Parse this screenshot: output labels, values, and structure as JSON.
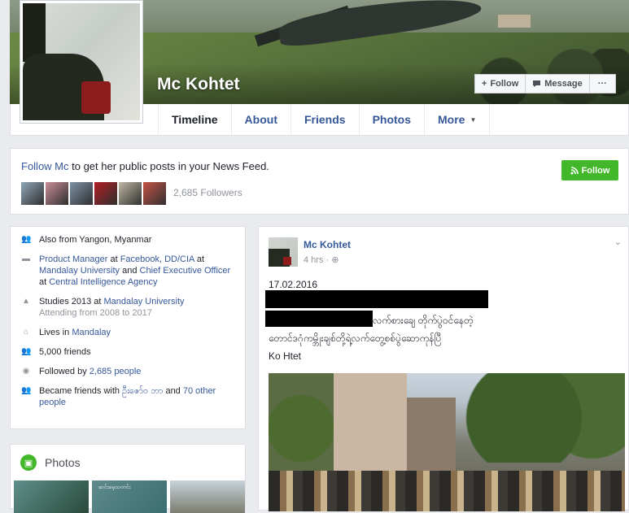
{
  "profile": {
    "name": "Mc Kohtet",
    "buttons": {
      "follow": "Follow",
      "message": "Message",
      "more": "···"
    }
  },
  "tabs": [
    "Timeline",
    "About",
    "Friends",
    "Photos",
    "More"
  ],
  "follow_box": {
    "prefix": "Follow Mc",
    "suffix": " to get her public posts in your News Feed.",
    "followers": "2,685 Followers",
    "button": "Follow",
    "avatar_colors": [
      "#8fa7b8",
      "#c98d99",
      "#7d92a8",
      "#b21f24",
      "#bfb7a4",
      "#c65346"
    ]
  },
  "intro": [
    {
      "icon": "people-icon",
      "pre": "Also from Yangon, Myanmar"
    },
    {
      "icon": "briefcase-icon",
      "pre": "",
      "text": "Product Manager at Facebook, DD/CIA at Mandalay University and Chief Executive Officer at Central Intelligence Agency"
    },
    {
      "icon": "graduation-icon",
      "text": "Studies 2013 at Mandalay University",
      "sub": "Attending from 2008 to 2017"
    },
    {
      "icon": "home-icon",
      "text": "Lives in Mandalay"
    },
    {
      "icon": "people-icon",
      "text": "5,000 friends"
    },
    {
      "icon": "rss-icon",
      "text": "Followed by 2,685 people"
    },
    {
      "icon": "people-icon",
      "text": "Became friends with ဦးဇော်ဝ ဘာ and 70 other people"
    }
  ],
  "photos_card": {
    "title": "Photos",
    "thumb_label": "ဆင်းမေ့သတင်း"
  },
  "post": {
    "author": "Mc Kohtet",
    "time": "4 hrs · ",
    "date": "17.02.2016",
    "line2": "လက်စားချေ တိုက်ပွဲဝင်နေတဲ့",
    "line3": "တောင်ဒဂုံကမ္ဘိုးချစ်တို့ရဲ့လက်တွေ့စစ်ပွဲဆောကုန်ပြီ",
    "sign": "Ko Htet"
  }
}
